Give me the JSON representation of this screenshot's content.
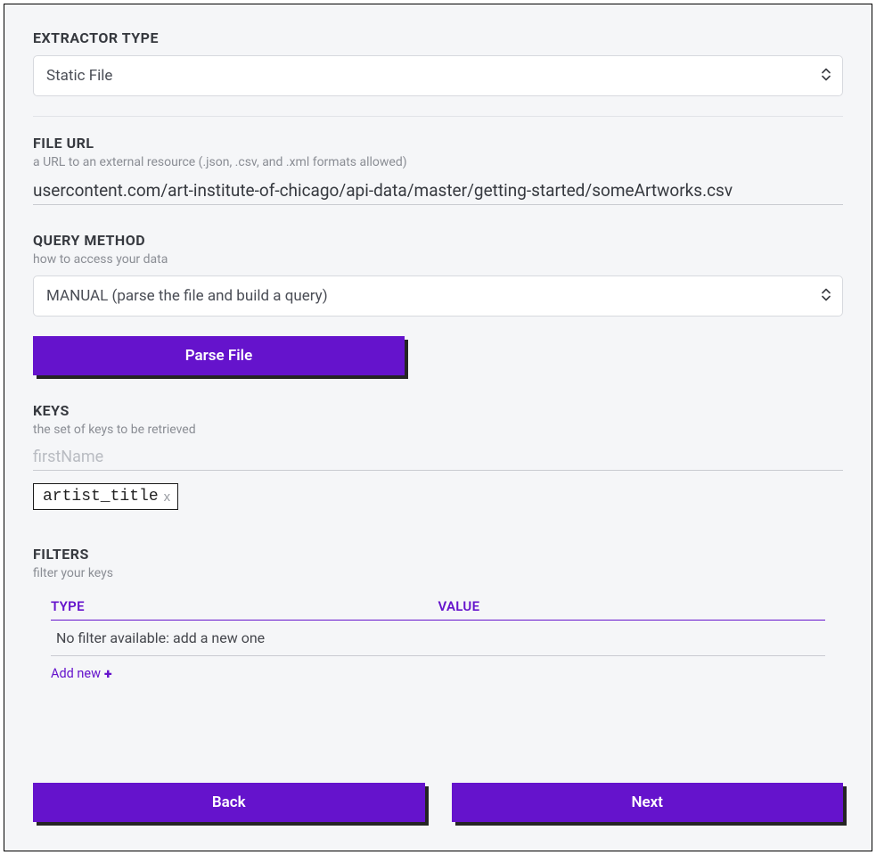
{
  "extractor": {
    "label": "EXTRACTOR TYPE",
    "value": "Static File"
  },
  "fileUrl": {
    "label": "FILE URL",
    "sub": "a URL to an external resource (.json, .csv, and .xml formats allowed)",
    "value": "usercontent.com/art-institute-of-chicago/api-data/master/getting-started/someArtworks.csv"
  },
  "queryMethod": {
    "label": "QUERY METHOD",
    "sub": "how to access your data",
    "value": "MANUAL (parse the file and build a query)"
  },
  "parseButton": "Parse File",
  "keys": {
    "label": "KEYS",
    "sub": "the set of keys to be retrieved",
    "placeholder": "firstName",
    "tags": [
      "artist_title"
    ],
    "tagClose": "x"
  },
  "filters": {
    "label": "FILTERS",
    "sub": "filter your keys",
    "colType": "TYPE",
    "colValue": "VALUE",
    "empty": "No filter available: add a new one",
    "addNew": "Add new"
  },
  "nav": {
    "back": "Back",
    "next": "Next"
  }
}
